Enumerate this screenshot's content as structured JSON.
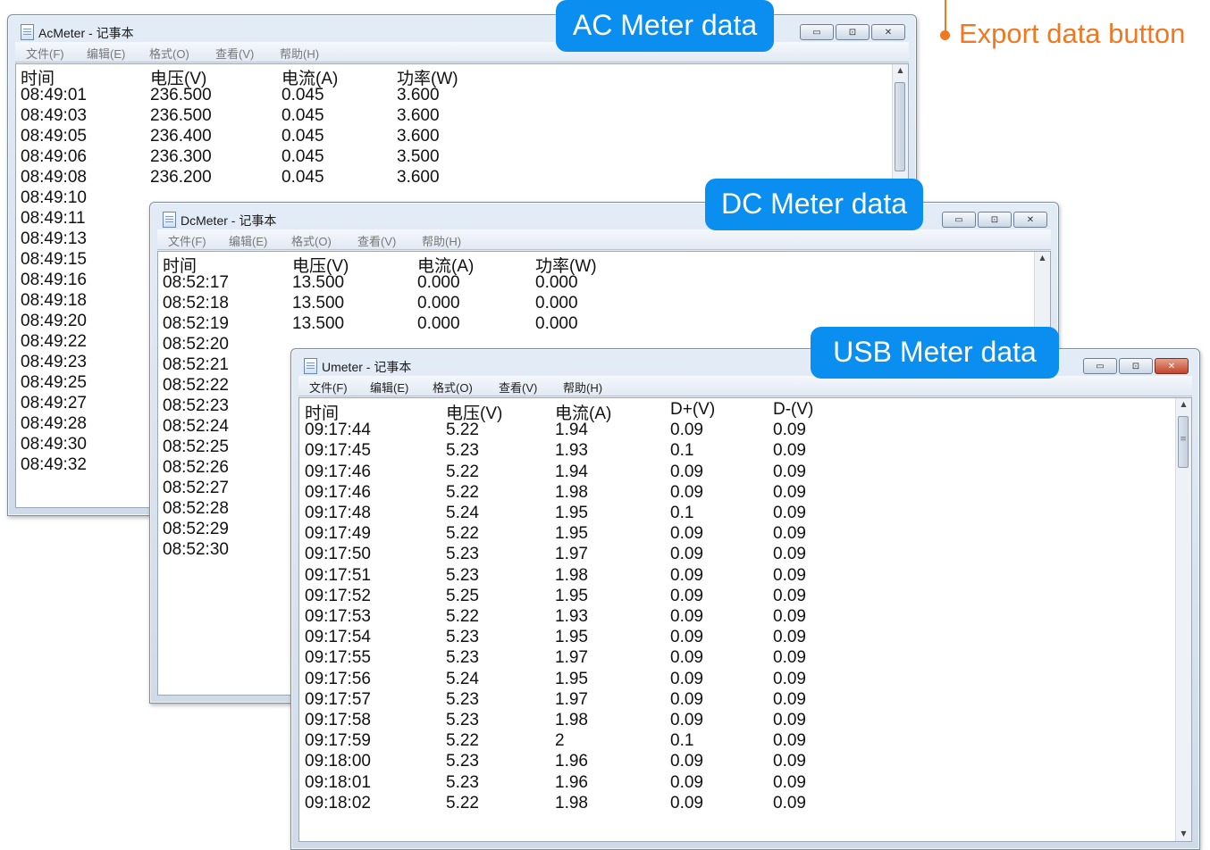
{
  "menu": [
    "文件(F)",
    "编辑(E)",
    "格式(O)",
    "查看(V)",
    "帮助(H)"
  ],
  "window_controls": {
    "minimize": "▭",
    "maximize": "⊡",
    "close": "✕"
  },
  "callouts": {
    "ac": "AC Meter data",
    "dc": "DC Meter data",
    "usb": "USB Meter data",
    "export": "Export data button"
  },
  "ac_window": {
    "title": "AcMeter - 记事本",
    "headers": [
      "时间",
      "电压(V)",
      "电流(A)",
      "功率(W)"
    ],
    "rows": [
      [
        "08:49:01",
        "236.500",
        "0.045",
        "3.600"
      ],
      [
        "08:49:03",
        "236.500",
        "0.045",
        "3.600"
      ],
      [
        "08:49:05",
        "236.400",
        "0.045",
        "3.600"
      ],
      [
        "08:49:06",
        "236.300",
        "0.045",
        "3.500"
      ],
      [
        "08:49:08",
        "236.200",
        "0.045",
        "3.600"
      ],
      [
        "08:49:10"
      ],
      [
        "08:49:11"
      ],
      [
        "08:49:13"
      ],
      [
        "08:49:15"
      ],
      [
        "08:49:16"
      ],
      [
        "08:49:18"
      ],
      [
        "08:49:20"
      ],
      [
        "08:49:22"
      ],
      [
        "08:49:23"
      ],
      [
        "08:49:25"
      ],
      [
        "08:49:27"
      ],
      [
        "08:49:28"
      ],
      [
        "08:49:30"
      ],
      [
        "08:49:32"
      ]
    ]
  },
  "dc_window": {
    "title": "DcMeter - 记事本",
    "headers": [
      "时间",
      "电压(V)",
      "电流(A)",
      "功率(W)"
    ],
    "rows": [
      [
        "08:52:17",
        "13.500",
        "0.000",
        "0.000"
      ],
      [
        "08:52:18",
        "13.500",
        "0.000",
        "0.000"
      ],
      [
        "08:52:19",
        "13.500",
        "0.000",
        "0.000"
      ],
      [
        "08:52:20"
      ],
      [
        "08:52:21"
      ],
      [
        "08:52:22"
      ],
      [
        "08:52:23"
      ],
      [
        "08:52:24"
      ],
      [
        "08:52:25"
      ],
      [
        "08:52:26"
      ],
      [
        "08:52:27"
      ],
      [
        "08:52:28"
      ],
      [
        "08:52:29"
      ],
      [
        "08:52:30"
      ]
    ]
  },
  "usb_window": {
    "title": "Umeter - 记事本",
    "headers": [
      "时间",
      "电压(V)",
      "电流(A)",
      "D+(V)",
      "D-(V)"
    ],
    "rows": [
      [
        "09:17:44",
        "5.22",
        "1.94",
        "0.09",
        "0.09"
      ],
      [
        "09:17:45",
        "5.23",
        "1.93",
        "0.1",
        "0.09"
      ],
      [
        "09:17:46",
        "5.22",
        "1.94",
        "0.09",
        "0.09"
      ],
      [
        "09:17:46",
        "5.22",
        "1.98",
        "0.09",
        "0.09"
      ],
      [
        "09:17:48",
        "5.24",
        "1.95",
        "0.1",
        "0.09"
      ],
      [
        "09:17:49",
        "5.22",
        "1.95",
        "0.09",
        "0.09"
      ],
      [
        "09:17:50",
        "5.23",
        "1.97",
        "0.09",
        "0.09"
      ],
      [
        "09:17:51",
        "5.23",
        "1.98",
        "0.09",
        "0.09"
      ],
      [
        "09:17:52",
        "5.25",
        "1.95",
        "0.09",
        "0.09"
      ],
      [
        "09:17:53",
        "5.22",
        "1.93",
        "0.09",
        "0.09"
      ],
      [
        "09:17:54",
        "5.23",
        "1.95",
        "0.09",
        "0.09"
      ],
      [
        "09:17:55",
        "5.23",
        "1.97",
        "0.09",
        "0.09"
      ],
      [
        "09:17:56",
        "5.24",
        "1.95",
        "0.09",
        "0.09"
      ],
      [
        "09:17:57",
        "5.23",
        "1.97",
        "0.09",
        "0.09"
      ],
      [
        "09:17:58",
        "5.23",
        "1.98",
        "0.09",
        "0.09"
      ],
      [
        "09:17:59",
        "5.22",
        "2",
        "0.1",
        "0.09"
      ],
      [
        "09:18:00",
        "5.23",
        "1.96",
        "0.09",
        "0.09"
      ],
      [
        "09:18:01",
        "5.23",
        "1.96",
        "0.09",
        "0.09"
      ],
      [
        "09:18:02",
        "5.22",
        "1.98",
        "0.09",
        "0.09"
      ]
    ]
  }
}
